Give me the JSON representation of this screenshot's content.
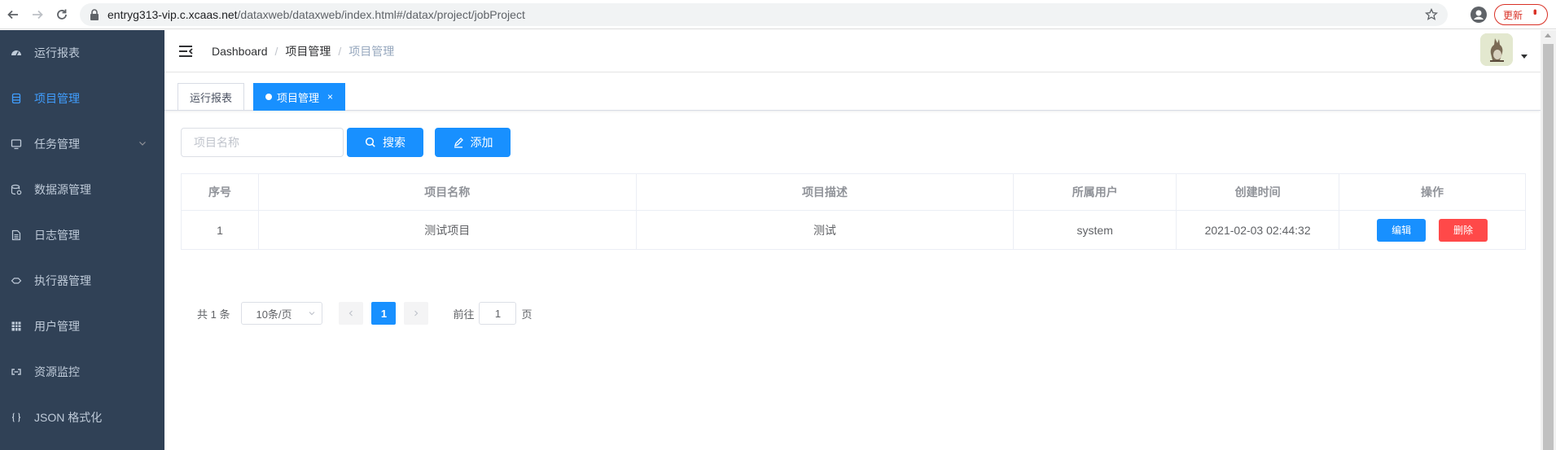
{
  "browser": {
    "url_host": "entryg313-vip.c.xcaas.net",
    "url_path": "/dataxweb/dataxweb/index.html#/datax/project/jobProject",
    "update_label": "更新"
  },
  "sidebar": {
    "items": [
      {
        "label": "运行报表",
        "icon": "dashboard-icon"
      },
      {
        "label": "项目管理",
        "icon": "database-icon",
        "active": true
      },
      {
        "label": "任务管理",
        "icon": "monitor-icon",
        "has_arrow": true
      },
      {
        "label": "数据源管理",
        "icon": "datasource-icon"
      },
      {
        "label": "日志管理",
        "icon": "document-icon"
      },
      {
        "label": "执行器管理",
        "icon": "executor-icon"
      },
      {
        "label": "用户管理",
        "icon": "table-icon"
      },
      {
        "label": "资源监控",
        "icon": "monitor-link-icon"
      },
      {
        "label": "JSON 格式化",
        "icon": "braces-icon"
      }
    ],
    "background": "#304156",
    "text_color": "#bfcbd9",
    "active_color": "#409eff"
  },
  "navbar": {
    "breadcrumb": [
      "Dashboard",
      "项目管理",
      "项目管理"
    ]
  },
  "tags": [
    {
      "label": "运行报表",
      "active": false
    },
    {
      "label": "项目管理",
      "active": true,
      "close": "×"
    }
  ],
  "filter": {
    "search_placeholder": "项目名称",
    "search_label": "搜索",
    "add_label": "添加"
  },
  "table": {
    "columns": [
      "序号",
      "项目名称",
      "项目描述",
      "所属用户",
      "创建时间",
      "操作"
    ],
    "rows": [
      {
        "index": "1",
        "name": "测试项目",
        "desc": "测试",
        "user": "system",
        "created": "2021-02-03 02:44:32"
      }
    ],
    "edit_label": "编辑",
    "delete_label": "删除"
  },
  "pagination": {
    "total": "共 1 条",
    "page_size": "10条/页",
    "current_page": "1",
    "goto_prefix": "前往",
    "goto_value": "1",
    "goto_suffix": "页"
  },
  "colors": {
    "primary": "#1890ff",
    "danger": "#ff4949"
  }
}
